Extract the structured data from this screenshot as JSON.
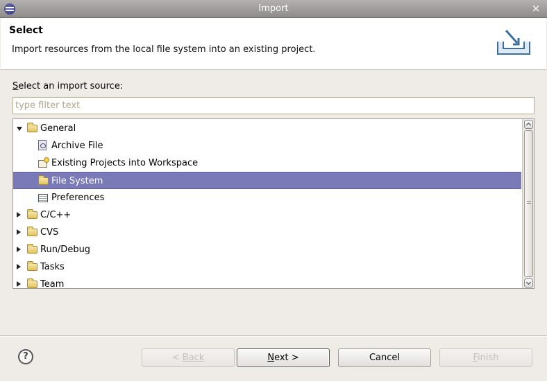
{
  "window": {
    "title": "Import",
    "close_glyph": "×"
  },
  "header": {
    "title": "Select",
    "description": "Import resources from the local file system into an existing project."
  },
  "filter": {
    "label_mnemonic": "S",
    "label_rest": "elect an import source:",
    "placeholder": "type filter text",
    "value": ""
  },
  "tree": {
    "items": [
      {
        "label": "General",
        "level": 0,
        "icon": "folder-open-icon",
        "state": "expanded",
        "selected": false
      },
      {
        "label": "Archive File",
        "level": 1,
        "icon": "archive-file-icon",
        "state": "leaf",
        "selected": false
      },
      {
        "label": "Existing Projects into Workspace",
        "level": 1,
        "icon": "project-icon",
        "state": "leaf",
        "selected": false
      },
      {
        "label": "File System",
        "level": 1,
        "icon": "folder-icon",
        "state": "leaf",
        "selected": true
      },
      {
        "label": "Preferences",
        "level": 1,
        "icon": "preferences-icon",
        "state": "leaf",
        "selected": false
      },
      {
        "label": "C/C++",
        "level": 0,
        "icon": "folder-icon",
        "state": "collapsed",
        "selected": false
      },
      {
        "label": "CVS",
        "level": 0,
        "icon": "folder-icon",
        "state": "collapsed",
        "selected": false
      },
      {
        "label": "Run/Debug",
        "level": 0,
        "icon": "folder-icon",
        "state": "collapsed",
        "selected": false
      },
      {
        "label": "Tasks",
        "level": 0,
        "icon": "folder-icon",
        "state": "collapsed",
        "selected": false
      },
      {
        "label": "Team",
        "level": 0,
        "icon": "folder-icon",
        "state": "collapsed",
        "selected": false
      }
    ]
  },
  "help": {
    "glyph": "?"
  },
  "buttons": {
    "back": {
      "mnemonic": "",
      "prefix": "< ",
      "text": "Back",
      "enabled": false
    },
    "next": {
      "mnemonic": "N",
      "rest": "ext >",
      "enabled": true,
      "default": true
    },
    "cancel": {
      "label": "Cancel",
      "enabled": true
    },
    "finish": {
      "mnemonic": "F",
      "rest": "inish",
      "enabled": false
    }
  },
  "colors": {
    "selection": "#7b7ab8",
    "title_bar": "#a19e9c",
    "dialog_bg": "#efebe7"
  }
}
